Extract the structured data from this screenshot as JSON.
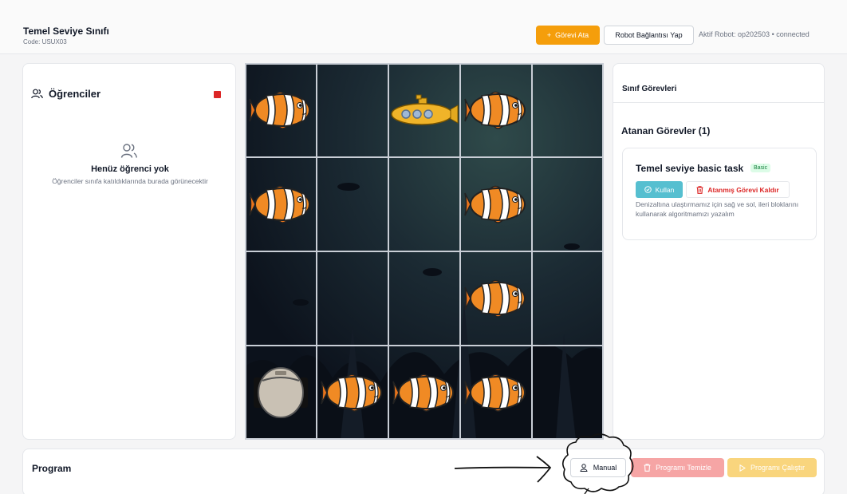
{
  "header": {
    "class_title": "Temel Seviye Sınıfı",
    "class_code": "Code: USUX03",
    "assign_button": "Görevi Ata",
    "robot_connect_button": "Robot Bağlantısı Yap",
    "active_robot": "Aktif Robot: op202503 • connected",
    "accent_color": "#f59e0b"
  },
  "students": {
    "title": "Öğrenciler",
    "empty_title": "Henüz öğrenci yok",
    "empty_description": "Öğrenciler sınıfa katıldıklarında burada görünecektir",
    "status_color": "#dc2626"
  },
  "board": {
    "columns": 5,
    "rows": 4,
    "cells": [
      {
        "row": 0,
        "col": 0,
        "item": "clownfish"
      },
      {
        "row": 0,
        "col": 2,
        "item": "submarine"
      },
      {
        "row": 0,
        "col": 3,
        "item": "clownfish"
      },
      {
        "row": 1,
        "col": 0,
        "item": "clownfish"
      },
      {
        "row": 1,
        "col": 3,
        "item": "clownfish"
      },
      {
        "row": 2,
        "col": 3,
        "item": "clownfish"
      },
      {
        "row": 3,
        "col": 0,
        "item": "robot"
      },
      {
        "row": 3,
        "col": 1,
        "item": "clownfish"
      },
      {
        "row": 3,
        "col": 2,
        "item": "clownfish"
      },
      {
        "row": 3,
        "col": 3,
        "item": "clownfish"
      }
    ]
  },
  "tasks": {
    "panel_title": "Sınıf Görevleri",
    "assigned_title": "Atanan Görevler (1)",
    "items": [
      {
        "name": "Temel seviye basic task",
        "badge": "Basic",
        "use_button": "Kullan",
        "remove_button": "Atanmış Görevi Kaldır",
        "description": "Denizaltına ulaştırmamız için sağ ve sol, ileri bloklarını kullanarak algoritmamızı yazalım"
      }
    ]
  },
  "program": {
    "title": "Program",
    "manual_button": "Manual",
    "clear_button": "Programı Temizle",
    "run_button": "Programı Çalıştır"
  }
}
